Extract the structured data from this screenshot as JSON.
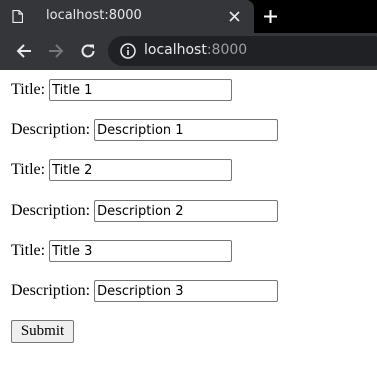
{
  "browser": {
    "tab": {
      "title": "localhost:8000"
    },
    "address_bar": {
      "host": "localhost",
      "port": ":8000"
    }
  },
  "form": {
    "entries": [
      {
        "title_label": "Title:",
        "title_value": "Title 1",
        "description_label": "Description:",
        "description_value": "Description 1"
      },
      {
        "title_label": "Title:",
        "title_value": "Title 2",
        "description_label": "Description:",
        "description_value": "Description 2"
      },
      {
        "title_label": "Title:",
        "title_value": "Title 3",
        "description_label": "Description:",
        "description_value": "Description 3"
      }
    ],
    "submit_label": "Submit"
  }
}
